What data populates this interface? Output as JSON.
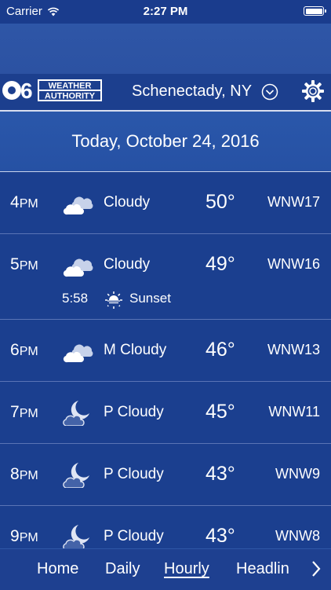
{
  "status_bar": {
    "carrier": "Carrier",
    "time": "2:27 PM"
  },
  "header": {
    "logo": {
      "channel": "6",
      "line1": "WEATHER",
      "line2": "AUTHORITY"
    },
    "location": "Schenectady, NY"
  },
  "date_label": "Today, October 24, 2016",
  "hours": [
    {
      "time": "4",
      "ampm": "PM",
      "icon": "cloudy-icon",
      "condition": "Cloudy",
      "temp": "50°",
      "wind": "WNW17"
    },
    {
      "time": "5",
      "ampm": "PM",
      "icon": "cloudy-icon",
      "condition": "Cloudy",
      "temp": "49°",
      "wind": "WNW16",
      "sunset": {
        "time": "5:58",
        "label": "Sunset"
      }
    },
    {
      "time": "6",
      "ampm": "PM",
      "icon": "cloudy-icon",
      "condition": "M Cloudy",
      "temp": "46°",
      "wind": "WNW13"
    },
    {
      "time": "7",
      "ampm": "PM",
      "icon": "moon-cloud-icon",
      "condition": "P Cloudy",
      "temp": "45°",
      "wind": "WNW11"
    },
    {
      "time": "8",
      "ampm": "PM",
      "icon": "moon-cloud-icon",
      "condition": "P Cloudy",
      "temp": "43°",
      "wind": "WNW9"
    },
    {
      "time": "9",
      "ampm": "PM",
      "icon": "moon-cloud-icon",
      "condition": "P Cloudy",
      "temp": "43°",
      "wind": "WNW8"
    }
  ],
  "tabs": [
    {
      "label": "Home",
      "active": false
    },
    {
      "label": "Daily",
      "active": false
    },
    {
      "label": "Hourly",
      "active": true
    },
    {
      "label": "Headlin",
      "active": false
    }
  ]
}
